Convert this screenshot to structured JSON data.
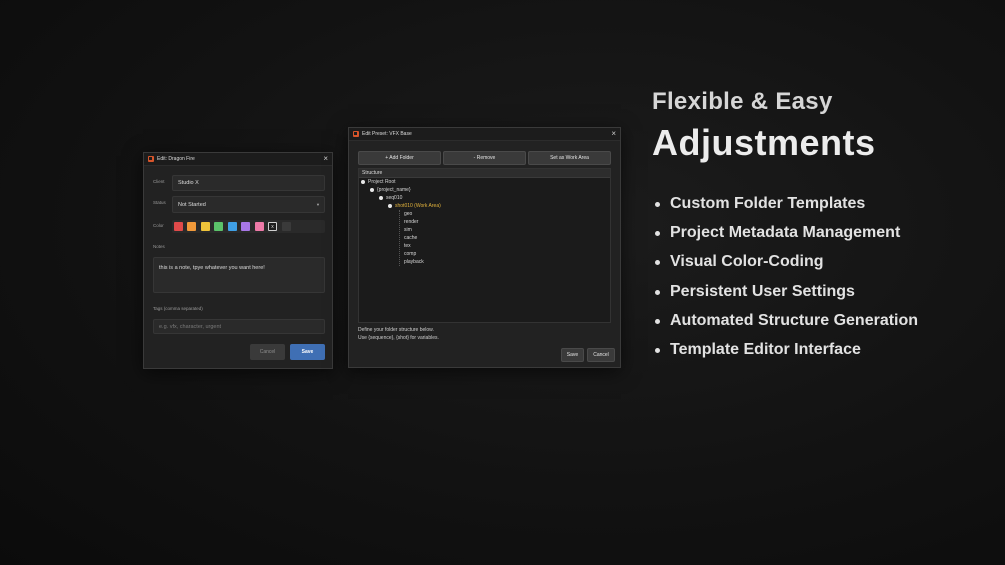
{
  "dialog1": {
    "title": "Edit: Dragon Fire",
    "client_label": "Client",
    "client_value": "Studio X",
    "status_label": "Status",
    "status_value": "Not Started",
    "color_label": "Color",
    "colors": [
      "#e04a4a",
      "#f29a3a",
      "#efc43a",
      "#5bc26a",
      "#3fa0e6",
      "#a877e6",
      "#ee7aa8"
    ],
    "clear_swatch_icon": "x",
    "notes_label": "Notes",
    "notes_value": "this is a note, tpye whatever you want here!",
    "tags_label": "Tags (comma separated)",
    "tags_placeholder": "e.g. vfx, character, urgent",
    "cancel_label": "Cancel",
    "save_label": "Save"
  },
  "dialog2": {
    "title": "Edit Preset: VFX Base",
    "add_folder_label": "+ Add Folder",
    "remove_label": "- Remove",
    "set_work_area_label": "Set as Work Area",
    "structure_header": "Structure",
    "tree": {
      "root": "Project Root",
      "project": "{project_name}",
      "seq": "seq010",
      "shot": "shot010 (Work Area)",
      "folders": [
        "geo",
        "render",
        "sim",
        "cache",
        "tex",
        "comp",
        "playback"
      ]
    },
    "hint_line1": "Define your folder structure below.",
    "hint_line2": "Use {sequence}, {shot} for variables.",
    "save_label": "Save",
    "cancel_label": "Cancel"
  },
  "headline": {
    "line1": "Flexible & Easy",
    "line2": "Adjustments"
  },
  "features": [
    "Custom Folder Templates",
    "Project Metadata Management",
    "Visual Color-Coding",
    "Persistent User Settings",
    "Automated Structure Generation",
    "Template Editor Interface"
  ],
  "colors": {
    "accent_save": "#3f6fb4",
    "work_area_highlight": "#e4b43c",
    "app_icon": "#d8552b"
  }
}
